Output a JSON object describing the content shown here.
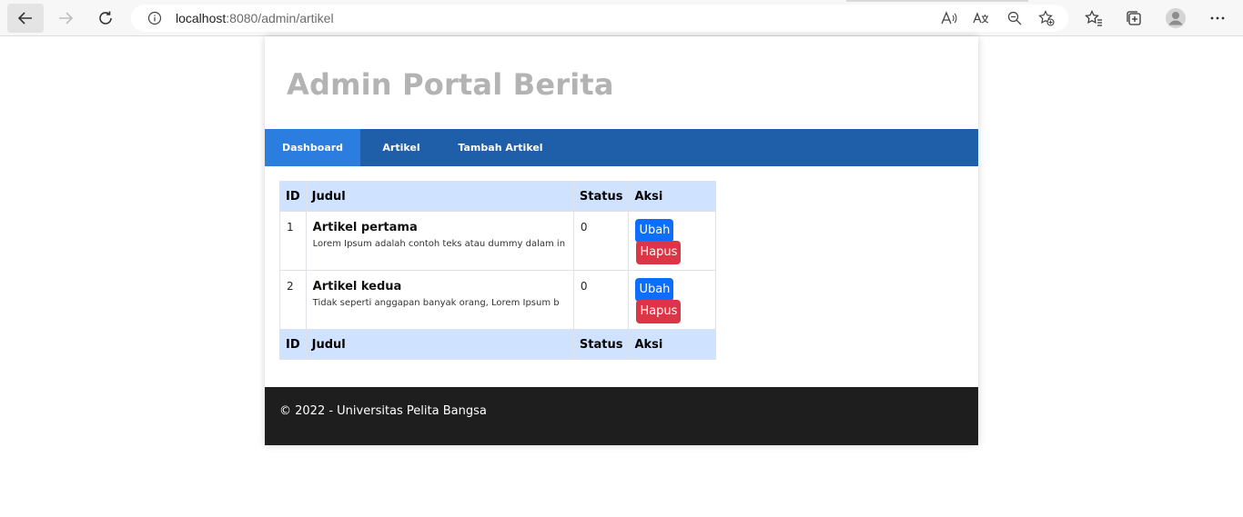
{
  "browser": {
    "url_host": "localhost",
    "url_path": ":8080/admin/artikel"
  },
  "site": {
    "title": "Admin Portal Berita"
  },
  "nav": {
    "items": [
      {
        "label": "Dashboard",
        "active": true
      },
      {
        "label": "Artikel",
        "active": false
      },
      {
        "label": "Tambah Artikel",
        "active": false
      }
    ]
  },
  "table": {
    "headers": [
      "ID",
      "Judul",
      "Status",
      "Aksi"
    ],
    "rows": [
      {
        "id": "1",
        "title": "Artikel pertama",
        "excerpt": "Lorem Ipsum adalah contoh teks atau dummy dalam in",
        "status": "0",
        "edit_label": "Ubah",
        "delete_label": "Hapus"
      },
      {
        "id": "2",
        "title": "Artikel kedua",
        "excerpt": "Tidak seperti anggapan banyak orang, Lorem Ipsum b",
        "status": "0",
        "edit_label": "Ubah",
        "delete_label": "Hapus"
      }
    ]
  },
  "footer": {
    "text": "© 2022 - Universitas Pelita Bangsa"
  },
  "colors": {
    "nav_bg": "#1f5fa9",
    "nav_active": "#2b7de0",
    "table_header": "#cfe2ff",
    "btn_edit": "#0d6efd",
    "btn_delete": "#dc3545",
    "footer_bg": "#1e1e1e"
  }
}
